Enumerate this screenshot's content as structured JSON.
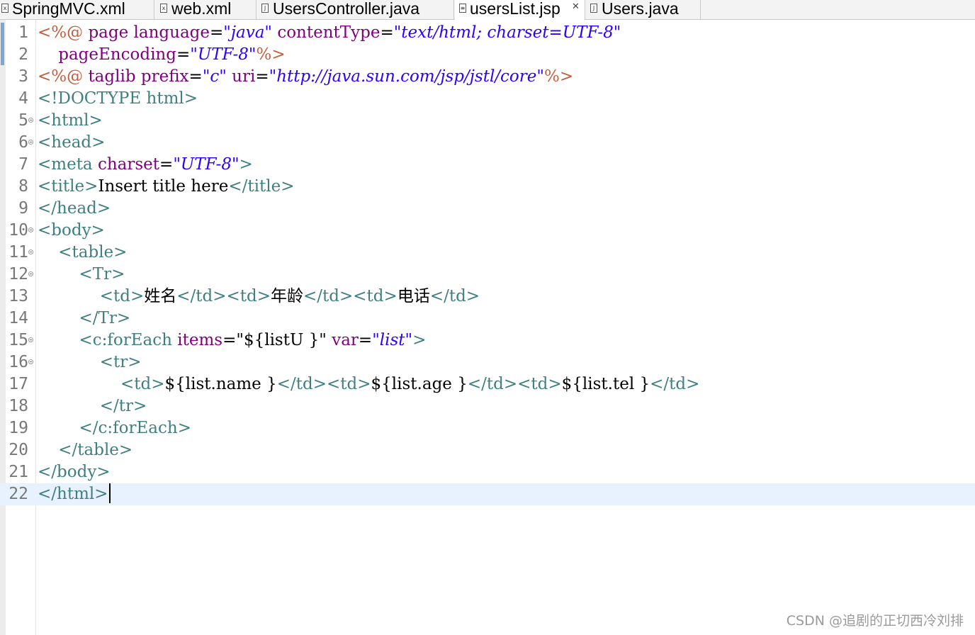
{
  "tabs": [
    {
      "label": "SpringMVC.xml",
      "icon": "xml-file-icon",
      "active": false
    },
    {
      "label": "web.xml",
      "icon": "xml-file-icon",
      "active": false
    },
    {
      "label": "UsersController.java",
      "icon": "java-file-icon",
      "active": false
    },
    {
      "label": "usersList.jsp",
      "icon": "jsp-file-icon",
      "active": true,
      "close": "✕"
    },
    {
      "label": "Users.java",
      "icon": "java-file-icon",
      "active": false
    }
  ],
  "editor": {
    "current_line": 22,
    "lines": [
      {
        "n": "1",
        "fold": false,
        "tokens": [
          [
            "jsp",
            "<%@ "
          ],
          [
            "attr",
            "page "
          ],
          [
            "attr",
            "language"
          ],
          [
            "txt",
            "="
          ],
          [
            "str",
            "\"java\""
          ],
          [
            "txt",
            " "
          ],
          [
            "attr",
            "contentType"
          ],
          [
            "txt",
            "="
          ],
          [
            "str",
            "\"text/html; charset=UTF-8\""
          ]
        ]
      },
      {
        "n": "2",
        "fold": false,
        "tokens": [
          [
            "txt",
            "    "
          ],
          [
            "attr",
            "pageEncoding"
          ],
          [
            "txt",
            "="
          ],
          [
            "str",
            "\"UTF-8\""
          ],
          [
            "jsp",
            "%>"
          ]
        ]
      },
      {
        "n": "3",
        "fold": false,
        "tokens": [
          [
            "jsp",
            "<%@ "
          ],
          [
            "attr",
            "taglib "
          ],
          [
            "attr",
            "prefix"
          ],
          [
            "txt",
            "="
          ],
          [
            "str",
            "\"c\""
          ],
          [
            "txt",
            " "
          ],
          [
            "attr",
            "uri"
          ],
          [
            "txt",
            "="
          ],
          [
            "str",
            "\"http://java.sun.com/jsp/jstl/core\""
          ],
          [
            "jsp",
            "%>"
          ]
        ]
      },
      {
        "n": "4",
        "fold": false,
        "tokens": [
          [
            "tag",
            "<!DOCTYPE html>"
          ]
        ]
      },
      {
        "n": "5",
        "fold": true,
        "tokens": [
          [
            "tag",
            "<html>"
          ]
        ]
      },
      {
        "n": "6",
        "fold": true,
        "tokens": [
          [
            "tag",
            "<head>"
          ]
        ]
      },
      {
        "n": "7",
        "fold": false,
        "tokens": [
          [
            "tag",
            "<meta "
          ],
          [
            "attr",
            "charset"
          ],
          [
            "txt",
            "="
          ],
          [
            "str",
            "\"UTF-8\""
          ],
          [
            "tag",
            ">"
          ]
        ]
      },
      {
        "n": "8",
        "fold": false,
        "tokens": [
          [
            "tag",
            "<title>"
          ],
          [
            "txt",
            "Insert title here"
          ],
          [
            "tag",
            "</title>"
          ]
        ]
      },
      {
        "n": "9",
        "fold": false,
        "tokens": [
          [
            "tag",
            "</head>"
          ]
        ]
      },
      {
        "n": "10",
        "fold": true,
        "tokens": [
          [
            "tag",
            "<body>"
          ]
        ]
      },
      {
        "n": "11",
        "fold": true,
        "tokens": [
          [
            "txt",
            "    "
          ],
          [
            "tag",
            "<table>"
          ]
        ]
      },
      {
        "n": "12",
        "fold": true,
        "tokens": [
          [
            "txt",
            "        "
          ],
          [
            "tag",
            "<Tr>"
          ]
        ]
      },
      {
        "n": "13",
        "fold": false,
        "tokens": [
          [
            "txt",
            "            "
          ],
          [
            "tag",
            "<td>"
          ],
          [
            "txt",
            "姓名"
          ],
          [
            "tag",
            "</td><td>"
          ],
          [
            "txt",
            "年龄"
          ],
          [
            "tag",
            "</td><td>"
          ],
          [
            "txt",
            "电话"
          ],
          [
            "tag",
            "</td>"
          ]
        ]
      },
      {
        "n": "14",
        "fold": false,
        "tokens": [
          [
            "txt",
            "        "
          ],
          [
            "tag",
            "</Tr>"
          ]
        ]
      },
      {
        "n": "15",
        "fold": true,
        "tokens": [
          [
            "txt",
            "        "
          ],
          [
            "tag",
            "<c:forEach "
          ],
          [
            "attr",
            "items"
          ],
          [
            "txt",
            "=\"${listU }\""
          ],
          [
            "strplain",
            " "
          ],
          [
            "attr",
            "var"
          ],
          [
            "txt",
            "="
          ],
          [
            "str",
            "\"list\""
          ],
          [
            "tag",
            ">"
          ]
        ]
      },
      {
        "n": "16",
        "fold": true,
        "tokens": [
          [
            "txt",
            "            "
          ],
          [
            "tag",
            "<tr>"
          ]
        ]
      },
      {
        "n": "17",
        "fold": false,
        "tokens": [
          [
            "txt",
            "                "
          ],
          [
            "tag",
            "<td>"
          ],
          [
            "txt",
            "${list.name }"
          ],
          [
            "tag",
            "</td><td>"
          ],
          [
            "txt",
            "${list.age }"
          ],
          [
            "tag",
            "</td><td>"
          ],
          [
            "txt",
            "${list.tel }"
          ],
          [
            "tag",
            "</td>"
          ]
        ]
      },
      {
        "n": "18",
        "fold": false,
        "tokens": [
          [
            "txt",
            "            "
          ],
          [
            "tag",
            "</tr>"
          ]
        ]
      },
      {
        "n": "19",
        "fold": false,
        "tokens": [
          [
            "txt",
            "        "
          ],
          [
            "tag",
            "</c:forEach>"
          ]
        ]
      },
      {
        "n": "20",
        "fold": false,
        "tokens": [
          [
            "txt",
            "    "
          ],
          [
            "tag",
            "</table>"
          ]
        ]
      },
      {
        "n": "21",
        "fold": false,
        "tokens": [
          [
            "tag",
            "</body>"
          ]
        ]
      },
      {
        "n": "22",
        "fold": false,
        "tokens": [
          [
            "tag",
            "</html>"
          ]
        ]
      }
    ]
  },
  "watermark": "CSDN @追剧的正切西冷刘排",
  "colors": {
    "tag": "#3f7f7f",
    "attr": "#7f007f",
    "string": "#2a00ff",
    "jsp_delimiter": "#bf5f3f",
    "current_line": "#e8f2fe"
  }
}
